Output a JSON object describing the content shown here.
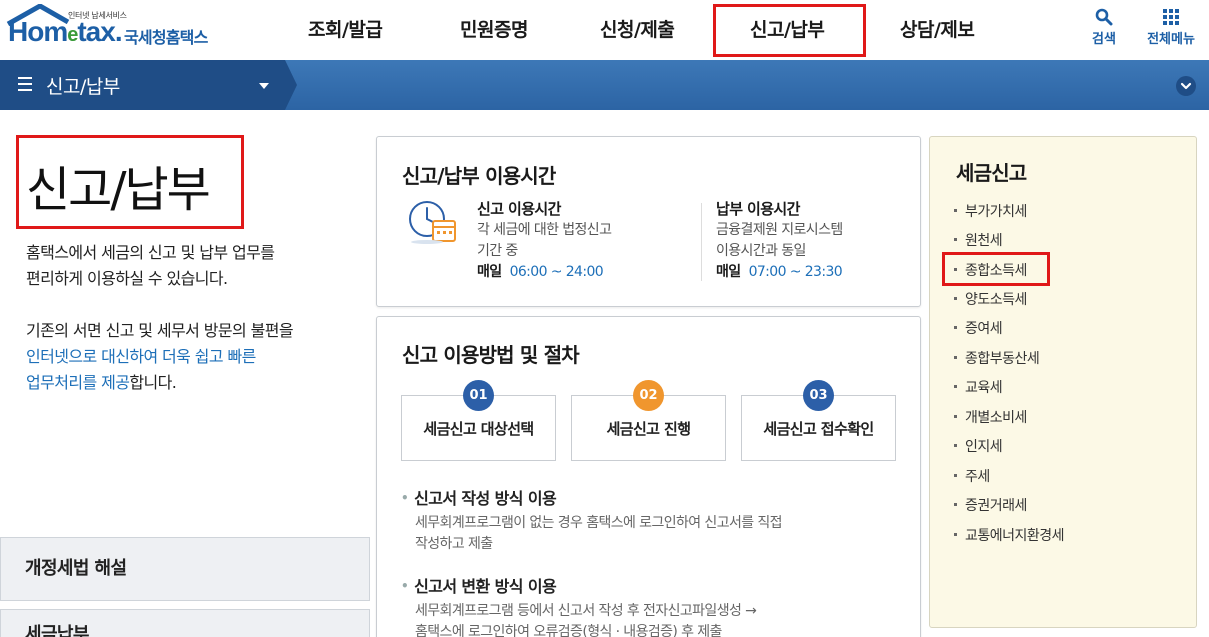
{
  "header": {
    "logo_tagline": "인터넷 납세서비스",
    "logo_brand_a": "Hom",
    "logo_brand_e": "e",
    "logo_brand_b": "tax.",
    "logo_agency": "국세청홈택스",
    "menu": [
      {
        "label": "조회/발급"
      },
      {
        "label": "민원증명"
      },
      {
        "label": "신청/제출"
      },
      {
        "label": "신고/납부",
        "active": true
      },
      {
        "label": "상담/제보"
      }
    ],
    "search_label": "검색",
    "allmenu_label": "전체메뉴",
    "icons": {
      "search": "search-icon",
      "allmenu": "grid-icon"
    }
  },
  "navbar": {
    "title": "신고/납부"
  },
  "left": {
    "page_title": "신고/납부",
    "desc1_line1": "홈택스에서 세금의 신고 및 납부 업무를",
    "desc1_line2": "편리하게 이용하실 수 있습니다.",
    "desc2_line1": "기존의 서면 신고 및 세무서 방문의 불편을",
    "desc2_line2_blue": "인터넷으로 대신하여 더욱 쉽고 빠른",
    "desc2_line3_blue": "업무처리를 제공",
    "desc2_line3_tail": "합니다.",
    "btn_law": "개정세법 해설",
    "btn_pay": "세금납부"
  },
  "hours": {
    "title": "신고/납부 이용시간",
    "report_title": "신고 이용시간",
    "report_desc1": "각 세금에 대한 법정신고",
    "report_desc2": "기간 중",
    "report_day": "매일",
    "report_time": "06:00 ~ 24:00",
    "pay_title": "납부 이용시간",
    "pay_desc1": "금융결제원 지로시스템",
    "pay_desc2": "이용시간과 동일",
    "pay_day": "매일",
    "pay_time": "07:00 ~ 23:30"
  },
  "procedure": {
    "title": "신고 이용방법 및 절차",
    "steps": [
      {
        "num": "01",
        "label": "세금신고 대상선택",
        "color": "#2c5fa8"
      },
      {
        "num": "02",
        "label": "세금신고 진행",
        "color": "#f0962e"
      },
      {
        "num": "03",
        "label": "세금신고 접수확인",
        "color": "#2c5fa8"
      }
    ],
    "methods": [
      {
        "title": "신고서 작성 방식 이용",
        "desc1": "세무회계프로그램이 없는 경우 홈택스에 로그인하여 신고서를 직접",
        "desc2": "작성하고 제출"
      },
      {
        "title": "신고서 변환 방식 이용",
        "desc1": "세무회계프로그램 등에서 신고서 작성 후 전자신고파일생성 →",
        "desc2": "홈택스에 로그인하여 오류검증(형식 · 내용검증) 후 제출"
      }
    ]
  },
  "tax_menu": {
    "title": "세금신고",
    "items": [
      "부가가치세",
      "원천세",
      "종합소득세",
      "양도소득세",
      "증여세",
      "종합부동산세",
      "교육세",
      "개별소비세",
      "인지세",
      "주세",
      "증권거래세",
      "교통에너지환경세"
    ],
    "highlighted": "종합소득세"
  },
  "colors": {
    "brand": "#1d5fa6",
    "highlight": "#e01818",
    "nav": "#2c64a4",
    "tax_panel_bg": "#fcf9e6"
  }
}
